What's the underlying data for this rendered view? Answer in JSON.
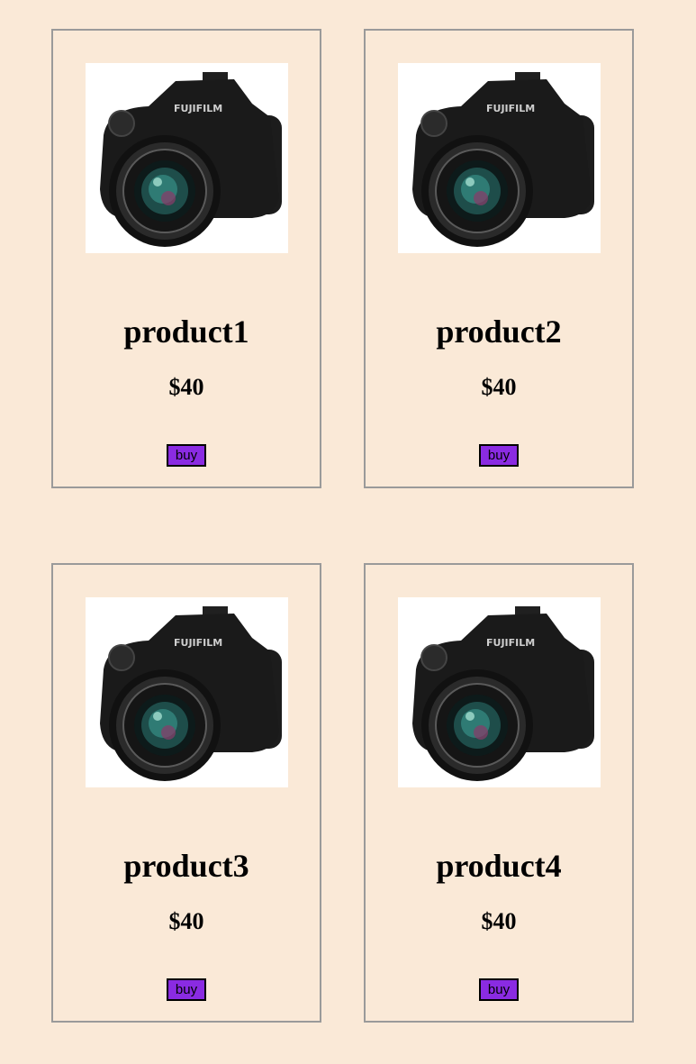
{
  "products": [
    {
      "name": "product1",
      "price": "$40",
      "buy_label": "buy",
      "brand": "FUJIFILM"
    },
    {
      "name": "product2",
      "price": "$40",
      "buy_label": "buy",
      "brand": "FUJIFILM"
    },
    {
      "name": "product3",
      "price": "$40",
      "buy_label": "buy",
      "brand": "FUJIFILM"
    },
    {
      "name": "product4",
      "price": "$40",
      "buy_label": "buy",
      "brand": "FUJIFILM"
    }
  ],
  "colors": {
    "page_background": "#fae9d7",
    "card_border": "#9a9a9a",
    "button_background": "#8a2be2"
  },
  "icons": {
    "product_image": "camera-photo"
  }
}
